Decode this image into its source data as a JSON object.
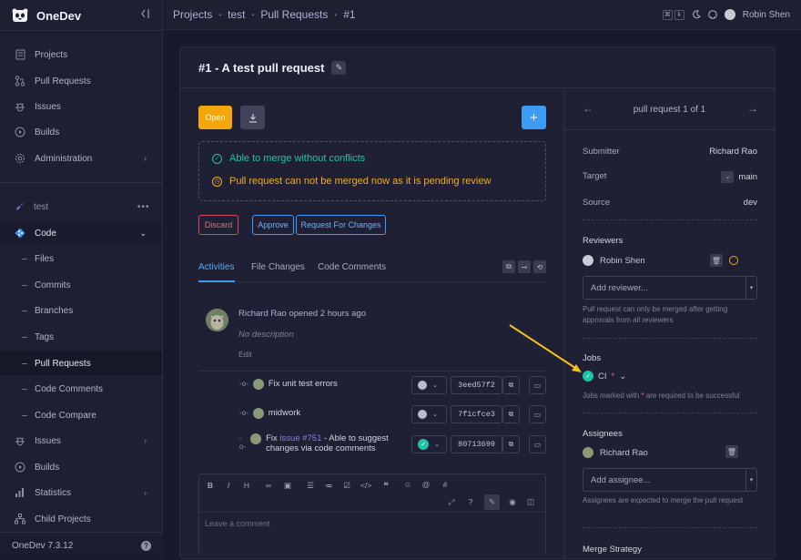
{
  "app": {
    "name": "OneDev",
    "version": "OneDev 7.3.12"
  },
  "sidebar": {
    "top_items": [
      {
        "label": "Projects",
        "icon": "projects-icon"
      },
      {
        "label": "Pull Requests",
        "icon": "pull-request-icon"
      },
      {
        "label": "Issues",
        "icon": "bug-icon"
      },
      {
        "label": "Builds",
        "icon": "play-icon"
      },
      {
        "label": "Administration",
        "icon": "gear-icon"
      }
    ],
    "project": "test",
    "code_label": "Code",
    "code_items": [
      "Files",
      "Commits",
      "Branches",
      "Tags",
      "Pull Requests",
      "Code Comments",
      "Code Compare"
    ],
    "bottom_items": [
      {
        "label": "Issues",
        "icon": "bug-icon"
      },
      {
        "label": "Builds",
        "icon": "play-icon"
      },
      {
        "label": "Statistics",
        "icon": "chart-icon"
      },
      {
        "label": "Child Projects",
        "icon": "tree-icon"
      }
    ]
  },
  "breadcrumb": [
    "Projects",
    "test",
    "Pull Requests",
    "#1"
  ],
  "user": {
    "name": "Robin Shen"
  },
  "shortcut_keys": [
    "⌘",
    "k"
  ],
  "pr": {
    "title": "#1 - A test pull request",
    "open_label": "Open",
    "merge_ok": "Able to merge without conflicts",
    "merge_warn": "Pull request can not be merged now as it is pending review",
    "actions": {
      "discard": "Discard",
      "approve": "Approve",
      "request": "Request For Changes"
    },
    "tabs": [
      "Activities",
      "File Changes",
      "Code Comments"
    ],
    "activity": {
      "author": "Richard Rao",
      "text": "opened 2 hours ago",
      "description": "No description",
      "edit": "Edit"
    },
    "commits": [
      {
        "message": "Fix unit test errors",
        "hash": "3eed57f2"
      },
      {
        "message": "midwork",
        "hash": "7f1cfce3"
      },
      {
        "prefix": "Fix ",
        "link": "issue #751",
        "suffix": " - Able to suggest changes via code comments",
        "hash": "80713699"
      }
    ],
    "comment_placeholder": "Leave a comment"
  },
  "side": {
    "pager": "pull request 1 of 1",
    "submitter_label": "Submitter",
    "submitter": "Richard Rao",
    "target_label": "Target",
    "target": "main",
    "source_label": "Source",
    "source": "dev",
    "reviewers_label": "Reviewers",
    "reviewer": "Robin Shen",
    "add_reviewer": "Add reviewer...",
    "reviewer_note": "Pull request can only be merged after getting approvals from all reviewers",
    "jobs_label": "Jobs",
    "job": "CI",
    "jobs_note_prefix": "Jobs marked with ",
    "jobs_note_star": "*",
    "jobs_note_suffix": " are required to be successful",
    "assignees_label": "Assignees",
    "assignee": "Richard Rao",
    "add_assignee": "Add assignee...",
    "assignee_note": "Assignees are expected to merge the pull request",
    "merge_strategy_label": "Merge Strategy"
  },
  "colors": {
    "accent": "#3d9bf5",
    "open": "#f5a60c",
    "success": "#1fc4a8",
    "warning": "#f0ae1d",
    "danger": "#d2465a",
    "annotation_arrow": "#f2c21b"
  }
}
